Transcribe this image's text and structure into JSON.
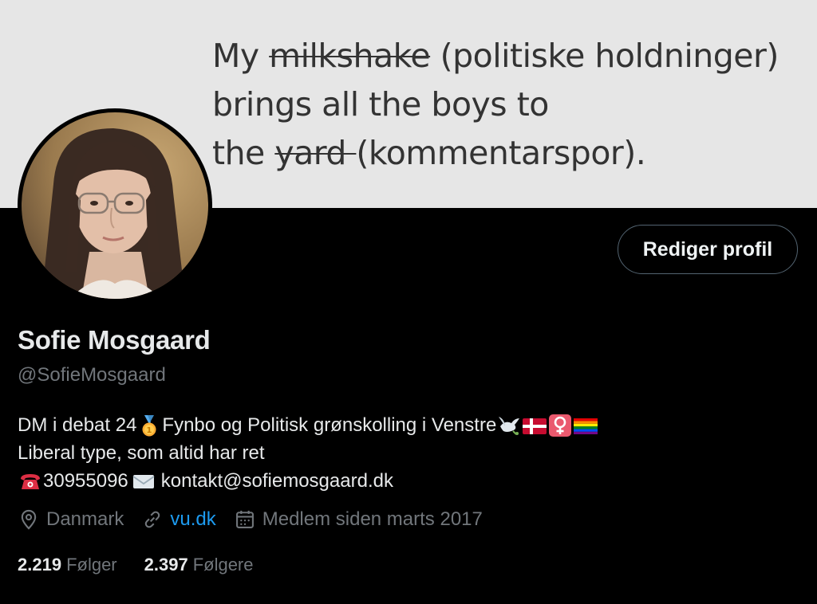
{
  "banner": {
    "line1_a": "My ",
    "line1_strike": "milkshake",
    "line1_b": " (politiske holdninger)",
    "line2": "brings all the boys to",
    "line3_a": "the ",
    "line3_strike": "yard ",
    "line3_b": "(kommentarspor)."
  },
  "profile": {
    "edit_label": "Rediger profil",
    "display_name": "Sofie Mosgaard",
    "handle": "@SofieMosgaard"
  },
  "bio": {
    "line1_a": "DM i debat 24",
    "line1_b": "Fynbo og Politisk grønskolling i Venstre ",
    "line2": "Liberal type, som altid har ret",
    "phone": "30955096",
    "email": "kontakt@sofiemosgaard.dk"
  },
  "meta": {
    "location": "Danmark",
    "website": "vu.dk",
    "joined": "Medlem siden marts 2017"
  },
  "stats": {
    "following_count": "2.219",
    "following_label": "Følger",
    "followers_count": "2.397",
    "followers_label": "Følgere"
  },
  "colors": {
    "background": "#000000",
    "banner": "#e6e6e6",
    "text_primary": "#e7e9ea",
    "text_secondary": "#71767b",
    "link": "#1d9bf0",
    "button_border": "#536471"
  },
  "icons": {
    "emoji1": "gold-medal-icon",
    "emoji2": "dove-icon",
    "emoji3": "denmark-flag-icon",
    "emoji4": "female-sign-icon",
    "emoji5": "rainbow-flag-icon",
    "phone_emoji": "telephone-icon",
    "email_emoji": "envelope-icon",
    "location": "location-pin-icon",
    "website": "link-icon",
    "joined": "calendar-icon"
  }
}
